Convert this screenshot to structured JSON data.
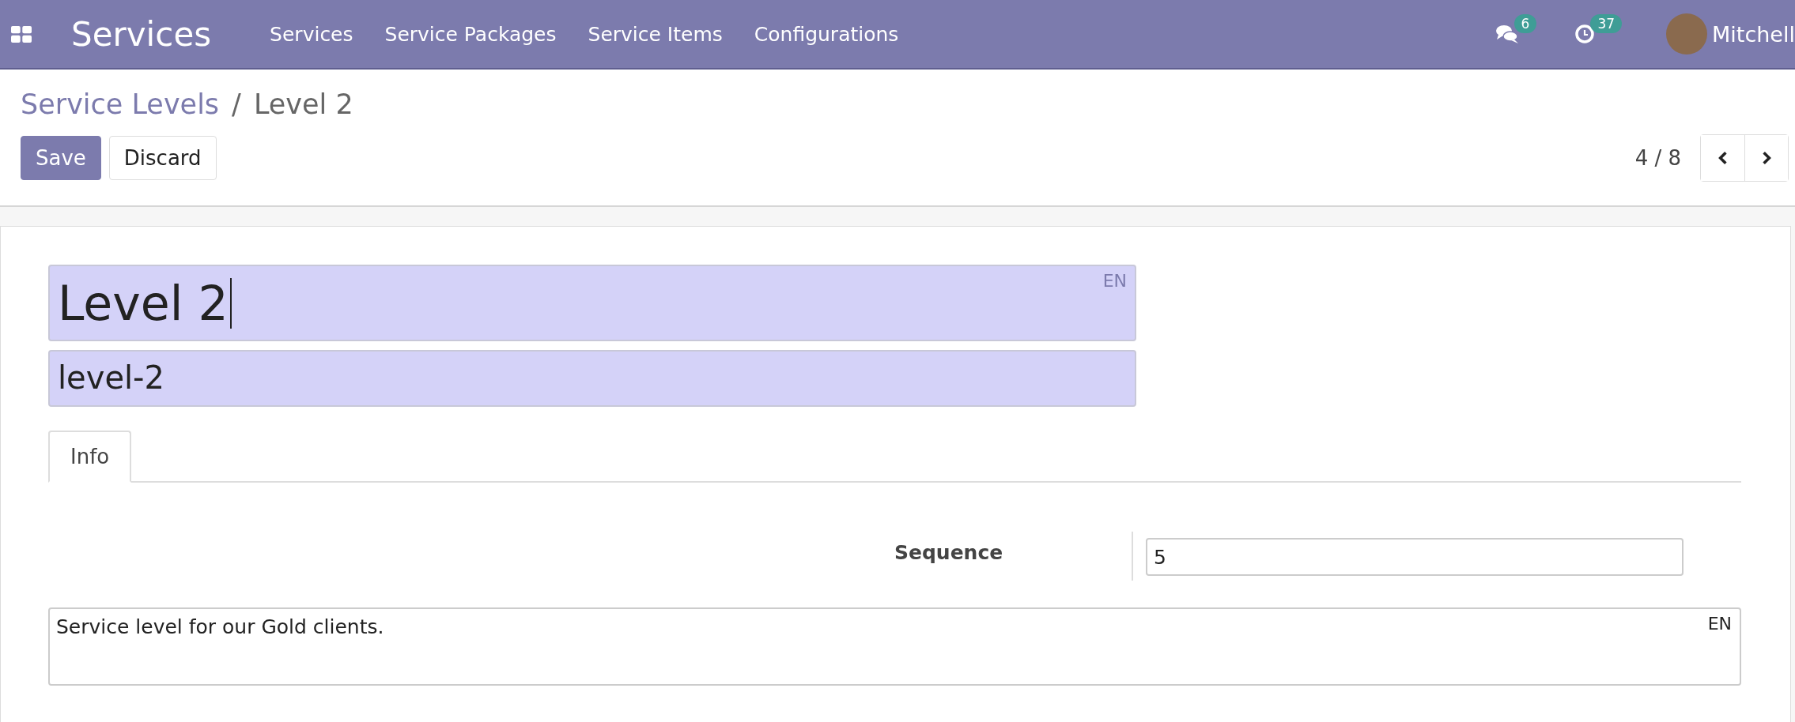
{
  "navbar": {
    "app_title": "Services",
    "menu": [
      {
        "label": "Services"
      },
      {
        "label": "Service Packages"
      },
      {
        "label": "Service Items"
      },
      {
        "label": "Configurations"
      }
    ],
    "messages_count": "6",
    "activities_count": "37",
    "user_name": "Mitchell"
  },
  "breadcrumb": {
    "parent": "Service Levels",
    "separator": "/",
    "current": "Level 2"
  },
  "buttons": [
    "Save",
    "Discard"
  ],
  "pager": {
    "value": "4 / 8"
  },
  "form": {
    "name": {
      "value": "Level 2",
      "language": "EN"
    },
    "slug": {
      "value": "level-2"
    },
    "tabs": [
      {
        "label": "Info",
        "selected": true
      }
    ],
    "fields": [
      {
        "label": "Sequence",
        "value": "5"
      }
    ],
    "description": {
      "value": "Service level for our Gold clients.",
      "language": "EN"
    }
  }
}
